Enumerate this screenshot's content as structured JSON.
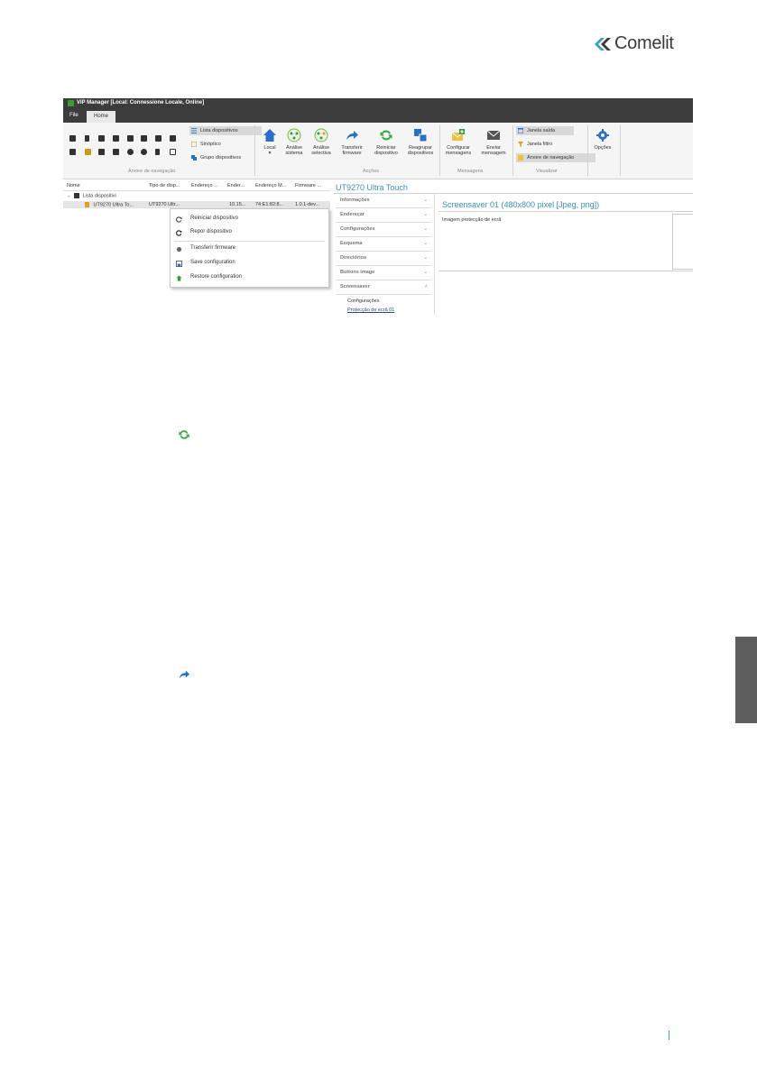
{
  "brand": {
    "logo_text": "Comelit",
    "accent_color": "#3aa0c8"
  },
  "app": {
    "window_title": "ViP Manager [Local: Connessione Locale, Online]",
    "menu": {
      "file": "File",
      "home_tab": "Home"
    },
    "ribbon": {
      "nav_group_label": "Árvore de navegação",
      "nav_items": [
        "Lista dispositivos",
        "Sinóptico",
        "Grupo dispositivos"
      ],
      "actions_group_label": "Acções",
      "actions": [
        {
          "label": "Local",
          "sub": "▾",
          "icon": "home-icon"
        },
        {
          "label": "Análise",
          "sub": "sistema",
          "icon": "network-icon"
        },
        {
          "label": "Análise",
          "sub": "selectiva",
          "icon": "network-select-icon"
        },
        {
          "label": "Transferir",
          "sub": "firmware",
          "icon": "forward-arrow-icon"
        },
        {
          "label": "Reiniciar",
          "sub": "dispositivo",
          "icon": "refresh-icon"
        },
        {
          "label": "Reagrupar",
          "sub": "dispositivos",
          "icon": "regroup-icon"
        }
      ],
      "messages_group_label": "Mensagens",
      "messages": [
        {
          "label": "Configurar",
          "sub": "mensagens",
          "icon": "envelope-plus-icon"
        },
        {
          "label": "Enviar",
          "sub": "mensagem",
          "icon": "envelope-icon"
        }
      ],
      "view_group_label": "Visualizar",
      "view_items": [
        "Janela saída",
        "Janela filtro",
        "Árvore de navegação"
      ],
      "options_label": "Opções"
    },
    "tree": {
      "columns": [
        "Nome",
        "Tipo de disp...",
        "Endereço ...",
        "Ender...",
        "Endereço M...",
        "Firmware ..."
      ],
      "root": "Lista dispositivi",
      "device_row": [
        "UT9270 Ultra To...",
        "UT9270 Ultr...",
        "",
        "10.15...",
        "74:E1:82:8...",
        "1.0.1-dev..."
      ]
    },
    "context_menu": [
      {
        "label": "Reiniciar dispositivo",
        "icon": "refresh-icon"
      },
      {
        "label": "Repor dispositivo",
        "icon": "reset-icon"
      },
      {
        "label": "Transferir firmware",
        "icon": "firmware-icon"
      },
      {
        "label": "Save configuration",
        "icon": "save-config-icon"
      },
      {
        "label": "Restore configuration",
        "icon": "restore-config-icon"
      }
    ],
    "device_panel": {
      "title": "UT9270 Ultra Touch",
      "sections": [
        "Informações",
        "Endereçar",
        "Configurações",
        "Esquema",
        "Directórios",
        "Buttons image",
        "Screensaver"
      ],
      "screensaver_sub": [
        "Configurações",
        "Protecção de ecrã 01"
      ],
      "content_title": "Screensaver 01 (480x800 pixel [Jpeg, png])",
      "content_label": "Imagem protecção de ecrã"
    }
  },
  "body_icons": [
    "refresh-icon",
    "forward-arrow-icon"
  ]
}
